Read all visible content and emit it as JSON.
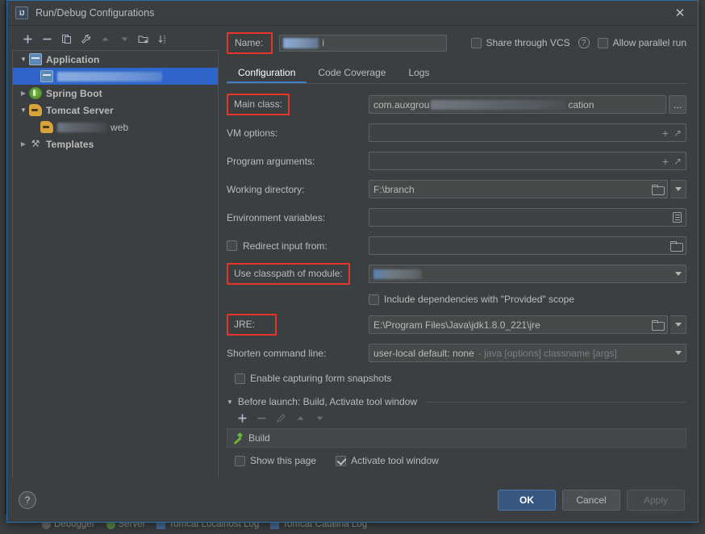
{
  "window": {
    "title": "Run/Debug Configurations",
    "app_icon": "intellij-idea-icon",
    "close_icon": "close-icon"
  },
  "tree_toolbar": {
    "buttons": [
      {
        "name": "add-configuration-button",
        "icon": "plus-icon",
        "label": "+",
        "enabled": true
      },
      {
        "name": "remove-configuration-button",
        "icon": "minus-icon",
        "label": "−",
        "enabled": true
      },
      {
        "name": "copy-configuration-button",
        "icon": "copy-icon",
        "label": "❐",
        "enabled": true
      },
      {
        "name": "edit-templates-button",
        "icon": "wrench-icon",
        "label": "⚒",
        "enabled": true
      },
      {
        "name": "move-up-button",
        "icon": "arrow-up-icon",
        "label": "▲",
        "enabled": false
      },
      {
        "name": "move-down-button",
        "icon": "arrow-down-icon",
        "label": "▼",
        "enabled": false
      },
      {
        "name": "new-folder-button",
        "icon": "folder-add-icon",
        "label": "▰",
        "enabled": true
      },
      {
        "name": "sort-configurations-button",
        "icon": "sort-icon",
        "label": "↧",
        "enabled": true
      }
    ]
  },
  "tree": {
    "items": [
      {
        "label": "Application",
        "icon": "application-icon",
        "twisty": "▼",
        "expanded": true,
        "depth": 0,
        "selected": false,
        "redacted": false
      },
      {
        "label": "",
        "icon": "application-config-icon",
        "twisty": "",
        "expanded": false,
        "depth": 1,
        "selected": true,
        "redacted": true
      },
      {
        "label": "Spring Boot",
        "icon": "spring-boot-icon",
        "twisty": "▶",
        "expanded": false,
        "depth": 0,
        "selected": false,
        "redacted": false
      },
      {
        "label": "Tomcat Server",
        "icon": "tomcat-icon",
        "twisty": "▼",
        "expanded": true,
        "depth": 0,
        "selected": false,
        "redacted": false
      },
      {
        "label": "web",
        "icon": "tomcat-config-icon",
        "twisty": "",
        "expanded": false,
        "depth": 1,
        "selected": false,
        "redacted": true
      },
      {
        "label": "Templates",
        "icon": "templates-wrench-icon",
        "twisty": "▶",
        "expanded": false,
        "depth": 0,
        "selected": false,
        "redacted": false
      }
    ]
  },
  "name_row": {
    "label": "Name:",
    "value": "",
    "value_suffix": "i",
    "value_redacted": true,
    "share_through_vcs": {
      "label": "Share through VCS",
      "checked": false
    },
    "help_icon": "help-icon",
    "allow_parallel_run": {
      "label": "Allow parallel run",
      "checked": false
    }
  },
  "tabs": [
    {
      "label": "Configuration",
      "active": true
    },
    {
      "label": "Code Coverage",
      "active": false
    },
    {
      "label": "Logs",
      "active": false
    }
  ],
  "form": {
    "main_class": {
      "label": "Main class:",
      "highlighted": true,
      "value_prefix": "com.auxgrou",
      "value_suffix": "cation",
      "value_redacted": true,
      "browse_label": "..."
    },
    "vm_options": {
      "label": "VM options:",
      "value": "",
      "add_icon": "plus-icon",
      "expand_icon": "expand-icon"
    },
    "program_arguments": {
      "label": "Program arguments:",
      "value": "",
      "add_icon": "plus-icon",
      "expand_icon": "expand-icon"
    },
    "working_directory": {
      "label": "Working directory:",
      "value": "F:\\branch",
      "browse_icon": "folder-icon",
      "dropdown_icon": "chevron-down-icon"
    },
    "environment_variables": {
      "label": "Environment variables:",
      "value": "",
      "browse_icon": "list-edit-icon"
    },
    "redirect_input_from": {
      "label": "Redirect input from:",
      "checked": false,
      "value": "",
      "browse_icon": "folder-icon"
    },
    "use_classpath_of_module": {
      "label": "Use classpath of module:",
      "highlighted": true,
      "value": "",
      "value_redacted": true,
      "dropdown_icon": "chevron-down-icon"
    },
    "include_provided_scope": {
      "label": "Include dependencies with \"Provided\" scope",
      "checked": false
    },
    "jre": {
      "label": "JRE:",
      "highlighted": true,
      "value": "E:\\Program Files\\Java\\jdk1.8.0_221\\jre",
      "browse_icon": "folder-icon",
      "dropdown_icon": "chevron-down-icon"
    },
    "shorten_command_line": {
      "label": "Shorten command line:",
      "value": "user-local default: none",
      "value_hint": "- java [options] classname [args]",
      "dropdown_icon": "chevron-down-icon"
    },
    "enable_capturing_form_snapshots": {
      "label": "Enable capturing form snapshots",
      "checked": false
    }
  },
  "before_launch": {
    "title": "Before launch: Build, Activate tool window",
    "twisty": "▼",
    "toolbar": [
      {
        "name": "add-task-button",
        "icon": "plus-icon",
        "label": "+",
        "enabled": true
      },
      {
        "name": "remove-task-button",
        "icon": "minus-icon",
        "label": "−",
        "enabled": false
      },
      {
        "name": "edit-task-button",
        "icon": "pencil-icon",
        "label": "✐",
        "enabled": false
      },
      {
        "name": "task-move-up-button",
        "icon": "arrow-up-icon",
        "label": "▲",
        "enabled": false
      },
      {
        "name": "task-move-down-button",
        "icon": "arrow-down-icon",
        "label": "▼",
        "enabled": false
      }
    ],
    "tasks": [
      {
        "label": "Build",
        "icon": "build-hammer-icon"
      }
    ],
    "show_this_page": {
      "label": "Show this page",
      "checked": false
    },
    "activate_tool_window": {
      "label": "Activate tool window",
      "checked": true
    }
  },
  "footer": {
    "help_icon": "help-icon",
    "ok": "OK",
    "cancel": "Cancel",
    "apply": "Apply",
    "apply_disabled": true
  },
  "ide_background": {
    "bottom_tabs": [
      {
        "label": "Debugger",
        "icon": "debugger-icon"
      },
      {
        "label": "Server",
        "icon": "server-icon"
      },
      {
        "label": "Tomcat Localhost Log",
        "icon": "log-icon"
      },
      {
        "label": "Tomcat Catalina Log",
        "icon": "log-icon"
      }
    ]
  },
  "colors": {
    "accent_blue": "#3d7ec2",
    "selection_blue": "#2f65ca",
    "annotation_red": "#e8352a",
    "primary_button": "#365880",
    "panel_bg": "#3c3f41",
    "field_bg": "#45494a",
    "text": "#bbbbbb"
  }
}
